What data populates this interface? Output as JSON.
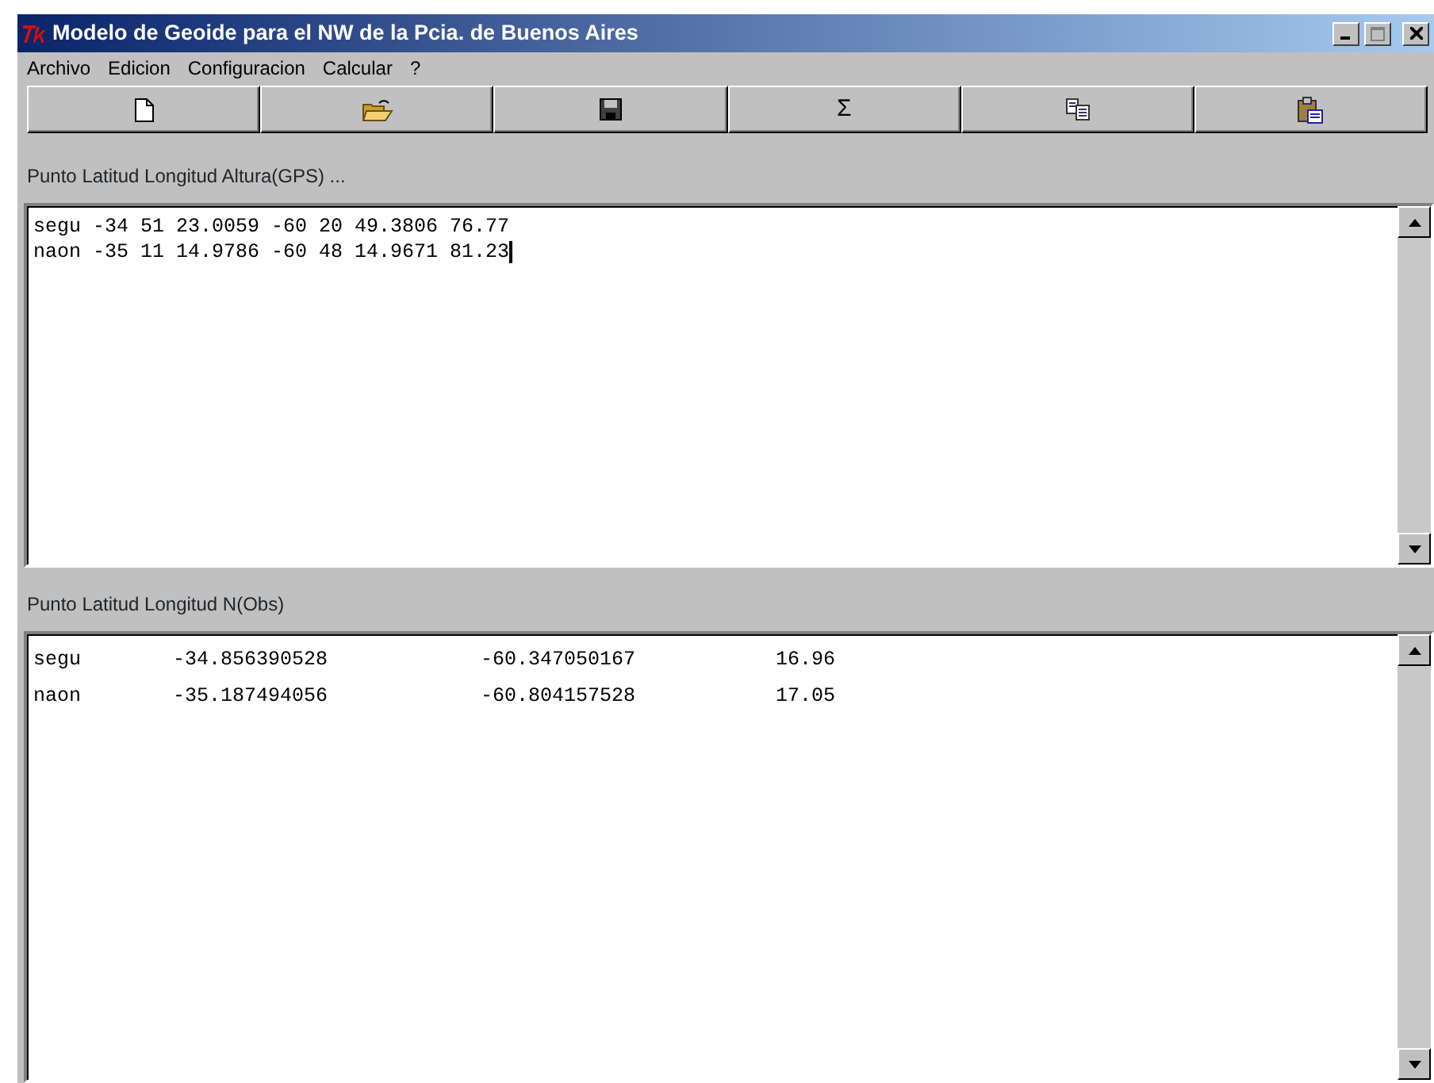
{
  "window": {
    "title": "Modelo de Geoide para el NW de la Pcia. de Buenos Aires"
  },
  "menu": [
    "Archivo",
    "Edicion",
    "Configuracion",
    "Calcular",
    "?"
  ],
  "toolbar": [
    {
      "kind": "new"
    },
    {
      "kind": "open"
    },
    {
      "kind": "save"
    },
    {
      "kind": "text",
      "label": "Σ"
    },
    {
      "kind": "copy"
    },
    {
      "kind": "paste"
    }
  ],
  "input_panel": {
    "label": "Punto Latitud Longitud Altura(GPS) ...",
    "lines": [
      "segu -34 51 23.0059 -60 20 49.3806 76.77",
      "naon -35 11 14.9786 -60 48 14.9671 81.23"
    ]
  },
  "output_panel": {
    "label": "Punto Latitud Longitud N(Obs)",
    "rows": [
      [
        "segu",
        "-34.856390528",
        "-60.347050167",
        "16.96"
      ],
      [
        "naon",
        "-35.187494056",
        "-60.804157528",
        "17.05"
      ]
    ]
  }
}
